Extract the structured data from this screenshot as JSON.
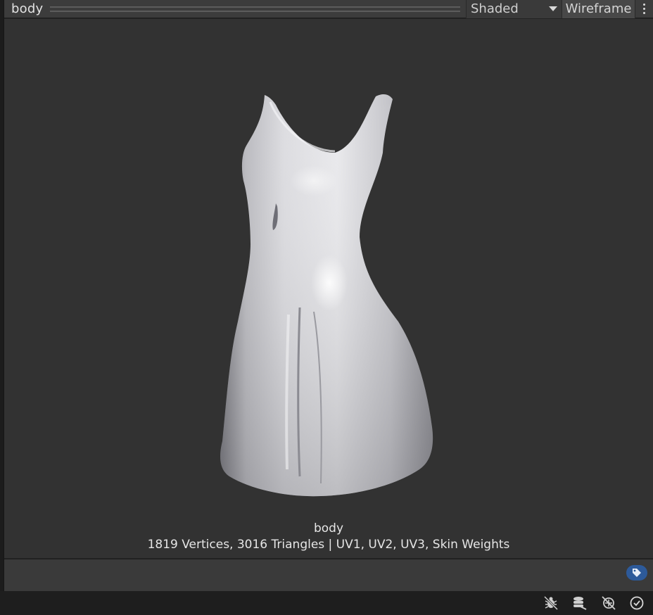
{
  "header": {
    "title": "body",
    "shading_mode": "Shaded",
    "wireframe_label": "Wireframe",
    "more_icon": "vertical-ellipsis-icon"
  },
  "preview": {
    "mesh_name": "body",
    "mesh_stats": "1819 Vertices, 3016 Triangles | UV1, UV2, UV3, Skin Weights",
    "subject": "dress-mesh"
  },
  "label_bar": {
    "tag_icon": "tag-icon",
    "accent": "#2d5a9a"
  },
  "status_bar": {
    "icons": [
      "debug-icon",
      "cache-server-icon",
      "auto-generate-lighting-icon",
      "check-icon"
    ]
  },
  "colors": {
    "viewport_bg": "#323232",
    "header_bg": "#3c3c3c",
    "text": "#e6e6e6"
  }
}
